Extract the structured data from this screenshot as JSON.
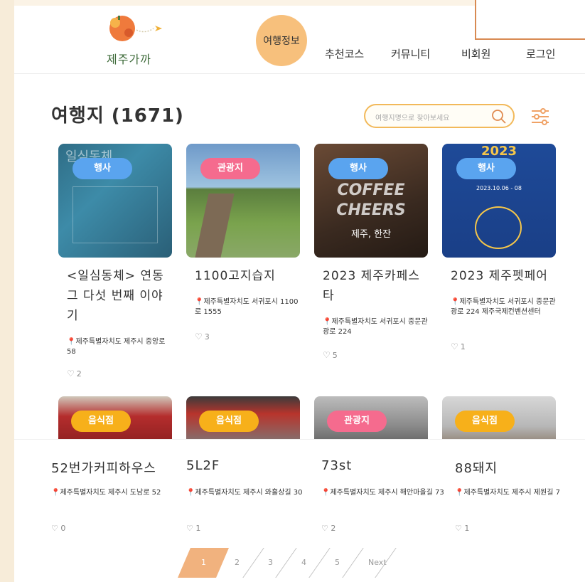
{
  "brand": {
    "name": "제주가까"
  },
  "nav": {
    "active": "여행정보",
    "items": [
      "추천코스",
      "커뮤니티",
      "비회원",
      "로그인"
    ]
  },
  "page_title": "여행지 (1671)",
  "search": {
    "placeholder": "여행지명으로 찾아보세요"
  },
  "cards": [
    {
      "badge": "행사",
      "name": "<일심동체> 연동 그 다섯 번째 이야기",
      "addr": "제주특별자치도 제주시 중앙로 58",
      "likes": "2",
      "thumb_text": "일심동체"
    },
    {
      "badge": "관광지",
      "name": "1100고지습지",
      "addr": "제주특별자치도 서귀포시 1100로 1555",
      "likes": "3"
    },
    {
      "badge": "행사",
      "name": "2023 제주카페스타",
      "addr": "제주특별자치도 서귀포시 중문관광로 224",
      "likes": "5",
      "thumb_text": "COFFEE CHEERS",
      "thumb_sub": "제주, 한잔"
    },
    {
      "badge": "행사",
      "name": "2023 제주펫페어",
      "addr": "제주특별자치도 서귀포시 중문관광로 224 제주국제컨벤션센터",
      "likes": "1",
      "thumb_text": "2023",
      "thumb_sub": "2023.10.06 - 08"
    }
  ],
  "cards2": [
    {
      "badge": "음식점",
      "name": "52번가커피하우스",
      "addr": "제주특별자치도 제주시 도남로 52",
      "likes": "0"
    },
    {
      "badge": "음식점",
      "name": "5L2F",
      "addr": "제주특별자치도 제주시 와흘상길 30",
      "likes": "1"
    },
    {
      "badge": "관광지",
      "name": "73st",
      "addr": "제주특별자치도 제주시 해안마을길 73",
      "likes": "2"
    },
    {
      "badge": "음식점",
      "name": "88돼지",
      "addr": "제주특별자치도 제주시 제원길 7",
      "likes": "1"
    }
  ],
  "pagination": {
    "pages": [
      "1",
      "2",
      "3",
      "4",
      "5"
    ],
    "next": "Next",
    "current": "1"
  },
  "colors": {
    "accent": "#f7c07c",
    "event": "#5aa4ef",
    "tour": "#f56b8e",
    "food": "#f7b01a"
  }
}
